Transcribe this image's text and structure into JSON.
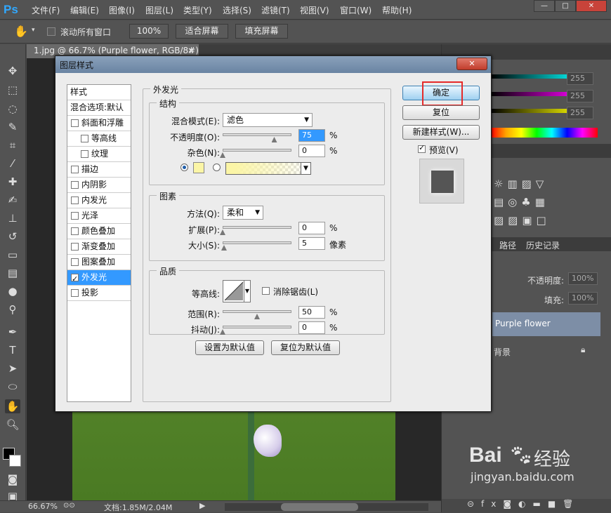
{
  "app": {
    "logo": "Ps"
  },
  "menu": [
    "文件(F)",
    "编辑(E)",
    "图像(I)",
    "图层(L)",
    "类型(Y)",
    "选择(S)",
    "滤镜(T)",
    "视图(V)",
    "窗口(W)",
    "帮助(H)"
  ],
  "window_controls": {
    "minimize": "—",
    "maximize": "□",
    "close": "✕"
  },
  "options": {
    "scroll_all_label": "滚动所有窗口",
    "zoom_100": "100%",
    "fit_screen": "适合屏幕",
    "fill_screen": "填充屏幕"
  },
  "document": {
    "tab_title": "1.jpg @ 66.7% (Purple flower, RGB/8#) *",
    "tab_close": "×"
  },
  "status": {
    "zoom": "66.67%",
    "doc_size": "文档:1.85M/2.04M"
  },
  "right_panel": {
    "color_values": [
      "255",
      "255",
      "255"
    ],
    "layers_tabs": [
      "路径",
      "历史记录"
    ],
    "opacity_label": "不透明度:",
    "opacity_value": "100%",
    "fill_label": "填充:",
    "fill_value": "100%",
    "layer_name": "Purple flower",
    "bg_layer_name": "背景"
  },
  "dialog": {
    "title": "图层样式",
    "close": "✕",
    "styles_header": "样式",
    "blend_options": "混合选项:默认",
    "styles": [
      {
        "label": "斜面和浮雕",
        "checked": false,
        "sub": false
      },
      {
        "label": "等高线",
        "checked": false,
        "sub": true
      },
      {
        "label": "纹理",
        "checked": false,
        "sub": true
      },
      {
        "label": "描边",
        "checked": false,
        "sub": false
      },
      {
        "label": "内阴影",
        "checked": false,
        "sub": false
      },
      {
        "label": "内发光",
        "checked": false,
        "sub": false
      },
      {
        "label": "光泽",
        "checked": false,
        "sub": false
      },
      {
        "label": "颜色叠加",
        "checked": false,
        "sub": false
      },
      {
        "label": "渐变叠加",
        "checked": false,
        "sub": false
      },
      {
        "label": "图案叠加",
        "checked": false,
        "sub": false
      },
      {
        "label": "外发光",
        "checked": true,
        "sub": false,
        "selected": true
      },
      {
        "label": "投影",
        "checked": false,
        "sub": false
      }
    ],
    "panel_title": "外发光",
    "structure": {
      "title": "结构",
      "blend_mode_label": "混合模式(E):",
      "blend_mode_value": "滤色",
      "opacity_label": "不透明度(O):",
      "opacity_value": "75",
      "opacity_unit": "%",
      "opacity_level": 0.75,
      "noise_label": "杂色(N):",
      "noise_value": "0",
      "noise_unit": "%",
      "noise_level": 0,
      "glow_color": "#fbf5a6"
    },
    "elements": {
      "title": "图素",
      "technique_label": "方法(Q):",
      "technique_value": "柔和",
      "spread_label": "扩展(P):",
      "spread_value": "0",
      "spread_unit": "%",
      "spread_level": 0,
      "size_label": "大小(S):",
      "size_value": "5",
      "size_unit": "像素",
      "size_level": 0.02
    },
    "quality": {
      "title": "品质",
      "contour_label": "等高线:",
      "antialias_label": "消除锯齿(L)",
      "range_label": "范围(R):",
      "range_value": "50",
      "range_unit": "%",
      "range_level": 0.5,
      "jitter_label": "抖动(J):",
      "jitter_value": "0",
      "jitter_unit": "%",
      "jitter_level": 0
    },
    "make_default": "设置为默认值",
    "reset_default": "复位为默认值",
    "ok": "确定",
    "reset": "复位",
    "new_style": "新建样式(W)...",
    "preview_label": "预览(V)"
  },
  "watermark": {
    "brand": "Bai",
    "brand2": "经验",
    "url": "jingyan.baidu.com"
  }
}
